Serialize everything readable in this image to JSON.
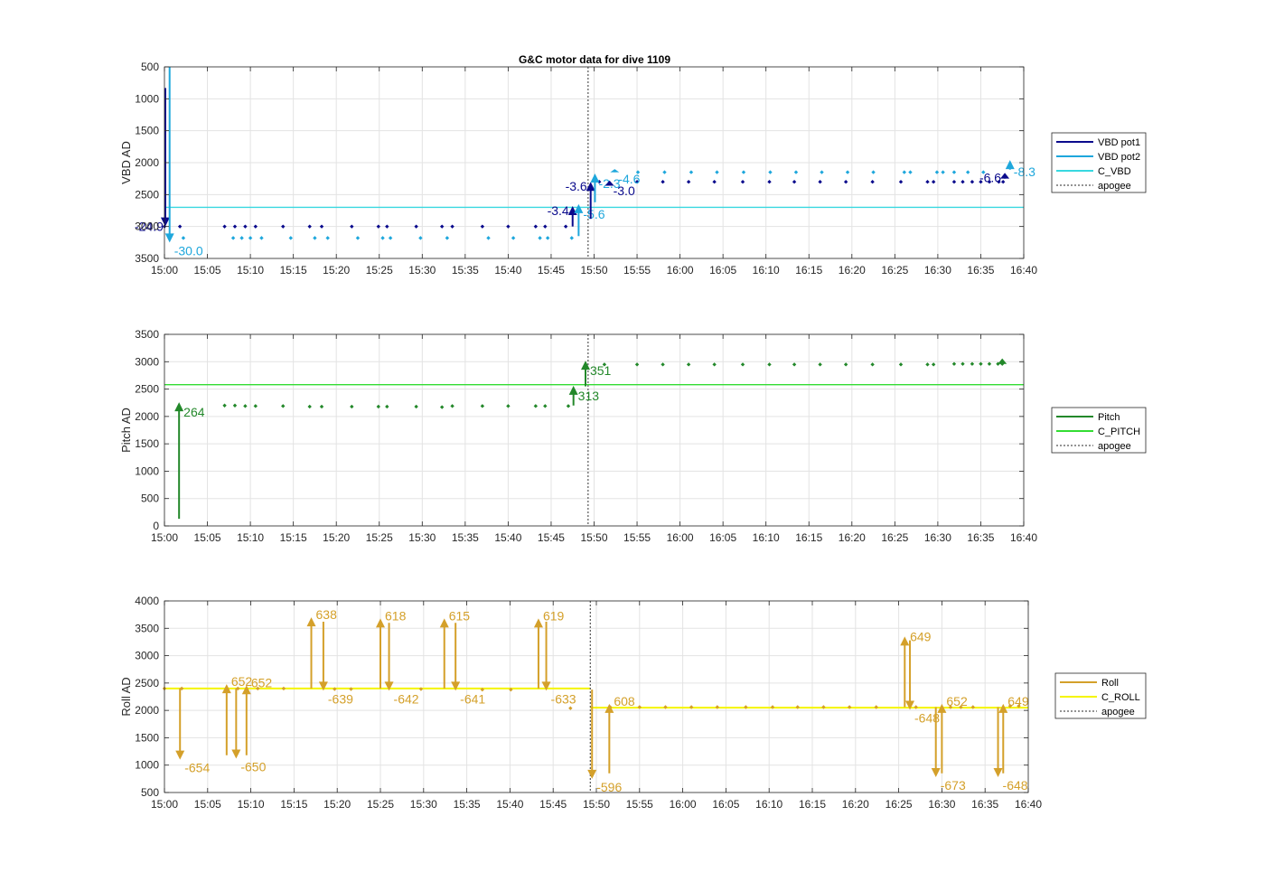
{
  "chart_data": [
    {
      "type": "scatter",
      "title": "G&C motor data for dive 1109",
      "ylabel": "VBD AD",
      "xlabel": "",
      "y_reversed": true,
      "ylim": [
        500,
        3500
      ],
      "y_ticks": [
        "500",
        "1000",
        "1500",
        "2000",
        "2500",
        "3000",
        "3500"
      ],
      "x_ticks": [
        "15:00",
        "15:05",
        "15:10",
        "15:15",
        "15:20",
        "15:25",
        "15:30",
        "15:35",
        "15:40",
        "15:45",
        "15:50",
        "15:55",
        "16:00",
        "16:05",
        "16:10",
        "16:15",
        "16:20",
        "16:25",
        "16:30",
        "16:35",
        "16:40"
      ],
      "xlim_minutes": [
        0,
        100
      ],
      "grid": true,
      "legend_position": "right",
      "legend": [
        "VBD pot1",
        "VBD pot2",
        "C_VBD",
        "apogee"
      ],
      "colors": {
        "pot1": "#0a0a8c",
        "pot2": "#1ea7dc",
        "c_line": "#38d8e0",
        "apogee": "#555555"
      },
      "c_line_value": 2700,
      "apogee_minute": 49.3,
      "series": [
        {
          "name": "VBD pot1",
          "points": [
            [
              0,
              3000
            ],
            [
              1.8,
              3000
            ],
            [
              7,
              3000
            ],
            [
              8.2,
              3000
            ],
            [
              9.4,
              3000
            ],
            [
              10.6,
              3000
            ],
            [
              13.8,
              3000
            ],
            [
              16.9,
              3000
            ],
            [
              18.3,
              3000
            ],
            [
              21.8,
              3000
            ],
            [
              24.9,
              3000
            ],
            [
              25.9,
              3000
            ],
            [
              29.3,
              3000
            ],
            [
              32.3,
              3000
            ],
            [
              33.5,
              3000
            ],
            [
              37,
              3000
            ],
            [
              40,
              3000
            ],
            [
              43.2,
              3000
            ],
            [
              44.3,
              3000
            ],
            [
              46.7,
              3000
            ],
            [
              50.6,
              2300
            ],
            [
              55,
              2300
            ],
            [
              58,
              2300
            ],
            [
              61,
              2300
            ],
            [
              64,
              2300
            ],
            [
              67.3,
              2300
            ],
            [
              70.4,
              2300
            ],
            [
              73.3,
              2300
            ],
            [
              76.3,
              2300
            ],
            [
              79.3,
              2300
            ],
            [
              82.4,
              2300
            ],
            [
              85.7,
              2300
            ],
            [
              88.8,
              2300
            ],
            [
              89.5,
              2300
            ],
            [
              91.9,
              2300
            ],
            [
              92.9,
              2300
            ],
            [
              94,
              2300
            ],
            [
              95,
              2300
            ],
            [
              96,
              2300
            ],
            [
              97.1,
              2300
            ],
            [
              97.6,
              2300
            ]
          ]
        },
        {
          "name": "VBD pot2",
          "points": [
            [
              2.2,
              3180
            ],
            [
              8,
              3180
            ],
            [
              9,
              3180
            ],
            [
              10,
              3180
            ],
            [
              11.3,
              3180
            ],
            [
              14.7,
              3180
            ],
            [
              17.5,
              3180
            ],
            [
              19,
              3180
            ],
            [
              22.5,
              3180
            ],
            [
              25.4,
              3180
            ],
            [
              26.3,
              3180
            ],
            [
              29.8,
              3180
            ],
            [
              32.9,
              3180
            ],
            [
              37.7,
              3180
            ],
            [
              40.6,
              3180
            ],
            [
              43.7,
              3180
            ],
            [
              44.6,
              3180
            ],
            [
              47.4,
              3180
            ],
            [
              55.1,
              2150
            ],
            [
              58.2,
              2150
            ],
            [
              61.3,
              2150
            ],
            [
              64.3,
              2150
            ],
            [
              67.4,
              2150
            ],
            [
              70.5,
              2150
            ],
            [
              73.5,
              2150
            ],
            [
              76.5,
              2150
            ],
            [
              79.5,
              2150
            ],
            [
              82.5,
              2150
            ],
            [
              86.1,
              2150
            ],
            [
              86.8,
              2150
            ],
            [
              89.9,
              2150
            ],
            [
              90.6,
              2150
            ],
            [
              91.9,
              2150
            ],
            [
              93.5,
              2150
            ],
            [
              95.3,
              2150
            ]
          ]
        }
      ],
      "arrows": [
        {
          "series": "VBD pot1",
          "x": 0.1,
          "from": 830,
          "to": 3000,
          "label": "-24.9"
        },
        {
          "series": "VBD pot2",
          "x": 0.6,
          "from": 500,
          "to": 3250,
          "label": "-30.0"
        },
        {
          "series": "VBD pot1",
          "x": 47.5,
          "from": 3000,
          "to": 2680,
          "label": "-3.4"
        },
        {
          "series": "VBD pot2",
          "x": 48.2,
          "from": 3150,
          "to": 2650,
          "label": "-5.6"
        },
        {
          "series": "VBD pot1",
          "x": 49.6,
          "from": 2880,
          "to": 2300,
          "label": "-3.6"
        },
        {
          "series": "VBD pot2",
          "x": 50.1,
          "from": 2620,
          "to": 2170,
          "label": "-2.3"
        },
        {
          "series": "VBD pot1",
          "x": 51.8,
          "from": 2360,
          "to": 2280,
          "label": "-3.0"
        },
        {
          "series": "VBD pot2",
          "x": 52.4,
          "from": 2150,
          "to": 2100,
          "label": "-4.6"
        },
        {
          "series": "VBD pot1",
          "x": 97.8,
          "from": 2250,
          "to": 2160,
          "label": "-6.6"
        },
        {
          "series": "VBD pot2",
          "x": 98.4,
          "from": 2110,
          "to": 1960,
          "label": "-8.3"
        }
      ]
    },
    {
      "type": "scatter",
      "ylabel": "Pitch AD",
      "xlabel": "",
      "ylim": [
        0,
        3500
      ],
      "y_ticks": [
        "0",
        "500",
        "1000",
        "1500",
        "2000",
        "2500",
        "3000",
        "3500"
      ],
      "x_ticks": [
        "15:00",
        "15:05",
        "15:10",
        "15:15",
        "15:20",
        "15:25",
        "15:30",
        "15:35",
        "15:40",
        "15:45",
        "15:50",
        "15:55",
        "16:00",
        "16:05",
        "16:10",
        "16:15",
        "16:20",
        "16:25",
        "16:30",
        "16:35",
        "16:40"
      ],
      "xlim_minutes": [
        0,
        100
      ],
      "grid": true,
      "legend_position": "right",
      "legend": [
        "Pitch",
        "C_PITCH",
        "apogee"
      ],
      "colors": {
        "series": "#23882a",
        "c_line": "#33dd33",
        "apogee": "#555555"
      },
      "c_line_value": 2580,
      "apogee_minute": 49.3,
      "series": [
        {
          "name": "Pitch",
          "points": [
            [
              7,
              2200
            ],
            [
              8.2,
              2200
            ],
            [
              9.4,
              2190
            ],
            [
              10.6,
              2190
            ],
            [
              13.8,
              2190
            ],
            [
              16.9,
              2180
            ],
            [
              18.3,
              2180
            ],
            [
              21.8,
              2180
            ],
            [
              24.9,
              2180
            ],
            [
              25.9,
              2180
            ],
            [
              29.3,
              2180
            ],
            [
              32.3,
              2170
            ],
            [
              33.5,
              2190
            ],
            [
              37,
              2190
            ],
            [
              40,
              2190
            ],
            [
              43.2,
              2190
            ],
            [
              44.3,
              2190
            ],
            [
              47,
              2190
            ],
            [
              51.2,
              2950
            ],
            [
              55,
              2950
            ],
            [
              58,
              2950
            ],
            [
              61,
              2950
            ],
            [
              64,
              2950
            ],
            [
              67.3,
              2950
            ],
            [
              70.4,
              2950
            ],
            [
              73.3,
              2950
            ],
            [
              76.3,
              2950
            ],
            [
              79.3,
              2950
            ],
            [
              82.4,
              2950
            ],
            [
              85.7,
              2950
            ],
            [
              88.8,
              2950
            ],
            [
              89.5,
              2950
            ],
            [
              91.9,
              2960
            ],
            [
              92.9,
              2960
            ],
            [
              94,
              2960
            ],
            [
              95,
              2960
            ],
            [
              96,
              2960
            ],
            [
              97,
              2960
            ],
            [
              97.5,
              2960
            ]
          ]
        }
      ],
      "arrows": [
        {
          "x": 1.7,
          "from": 130,
          "to": 2260,
          "label": "264"
        },
        {
          "x": 47.6,
          "from": 2200,
          "to": 2560,
          "label": "313"
        },
        {
          "x": 49,
          "from": 2550,
          "to": 3020,
          "label": "351"
        },
        {
          "x": 97.5,
          "from": 2960,
          "to": 3060,
          "label": ""
        }
      ]
    },
    {
      "type": "scatter",
      "ylabel": "Roll AD",
      "xlabel": "",
      "ylim": [
        500,
        4000
      ],
      "y_ticks": [
        "500",
        "1000",
        "1500",
        "2000",
        "2500",
        "3000",
        "3500",
        "4000"
      ],
      "x_ticks": [
        "15:00",
        "15:05",
        "15:10",
        "15:15",
        "15:20",
        "15:25",
        "15:30",
        "15:35",
        "15:40",
        "15:45",
        "15:50",
        "15:55",
        "16:00",
        "16:05",
        "16:10",
        "16:15",
        "16:20",
        "16:25",
        "16:30",
        "16:35",
        "16:40"
      ],
      "xlim_minutes": [
        0,
        100
      ],
      "grid": true,
      "legend_position": "right",
      "legend": [
        "Roll",
        "C_ROLL",
        "apogee"
      ],
      "colors": {
        "series": "#d4a02a",
        "c_line": "#f5f500",
        "apogee": "#555555"
      },
      "c_line_value_before_apogee": 2400,
      "c_line_value_after_apogee": 2050,
      "apogee_minute": 49.3,
      "series": [
        {
          "name": "Roll",
          "points": [
            [
              0,
              2400
            ],
            [
              2,
              2400
            ],
            [
              8.5,
              2400
            ],
            [
              10.8,
              2400
            ],
            [
              13.8,
              2400
            ],
            [
              19.7,
              2390
            ],
            [
              21.6,
              2390
            ],
            [
              29.7,
              2390
            ],
            [
              36.8,
              2380
            ],
            [
              40.1,
              2380
            ],
            [
              47,
              2040
            ],
            [
              51.6,
              2060
            ],
            [
              55,
              2060
            ],
            [
              58,
              2060
            ],
            [
              61,
              2060
            ],
            [
              64,
              2060
            ],
            [
              67.3,
              2060
            ],
            [
              70.4,
              2060
            ],
            [
              73.3,
              2060
            ],
            [
              76.3,
              2060
            ],
            [
              79.3,
              2060
            ],
            [
              82.4,
              2060
            ],
            [
              87,
              2060
            ],
            [
              91,
              2060
            ],
            [
              92.2,
              2060
            ],
            [
              93.6,
              2060
            ],
            [
              97.9,
              2080
            ],
            [
              98.9,
              2080
            ]
          ]
        }
      ],
      "arrows": [
        {
          "x": 1.8,
          "from": 2400,
          "to": 1100,
          "label": "-654"
        },
        {
          "x": 7.2,
          "from": 1180,
          "to": 2480,
          "label": "652"
        },
        {
          "x": 8.3,
          "from": 2400,
          "to": 1120,
          "label": "-650"
        },
        {
          "x": 9.5,
          "from": 1180,
          "to": 2460,
          "label": "652"
        },
        {
          "x": 17,
          "from": 2400,
          "to": 3700,
          "label": "638"
        },
        {
          "x": 18.4,
          "from": 3620,
          "to": 2360,
          "label": "-639"
        },
        {
          "x": 25,
          "from": 2400,
          "to": 3680,
          "label": "618"
        },
        {
          "x": 26,
          "from": 3600,
          "to": 2360,
          "label": "-642"
        },
        {
          "x": 32.4,
          "from": 2400,
          "to": 3680,
          "label": "615"
        },
        {
          "x": 33.7,
          "from": 3600,
          "to": 2360,
          "label": "-641"
        },
        {
          "x": 43.3,
          "from": 2400,
          "to": 3680,
          "label": "619"
        },
        {
          "x": 44.2,
          "from": 3620,
          "to": 2360,
          "label": "-633"
        },
        {
          "x": 49.5,
          "from": 2380,
          "to": 750,
          "label": "-596"
        },
        {
          "x": 51.5,
          "from": 850,
          "to": 2120,
          "label": "608"
        },
        {
          "x": 85.7,
          "from": 2060,
          "to": 3350,
          "label": ""
        },
        {
          "x": 86.3,
          "from": 3280,
          "to": 2010,
          "label": "-648"
        },
        {
          "x": 89.3,
          "from": 2060,
          "to": 780,
          "label": "-673"
        },
        {
          "x": 90,
          "from": 850,
          "to": 2120,
          "label": "652"
        },
        {
          "x": 96.5,
          "from": 2060,
          "to": 780,
          "label": "-648"
        },
        {
          "x": 97.1,
          "from": 850,
          "to": 2120,
          "label": "649"
        },
        {
          "x": 86.1,
          "from": 3350,
          "to": 3350,
          "label": "649"
        }
      ]
    }
  ]
}
